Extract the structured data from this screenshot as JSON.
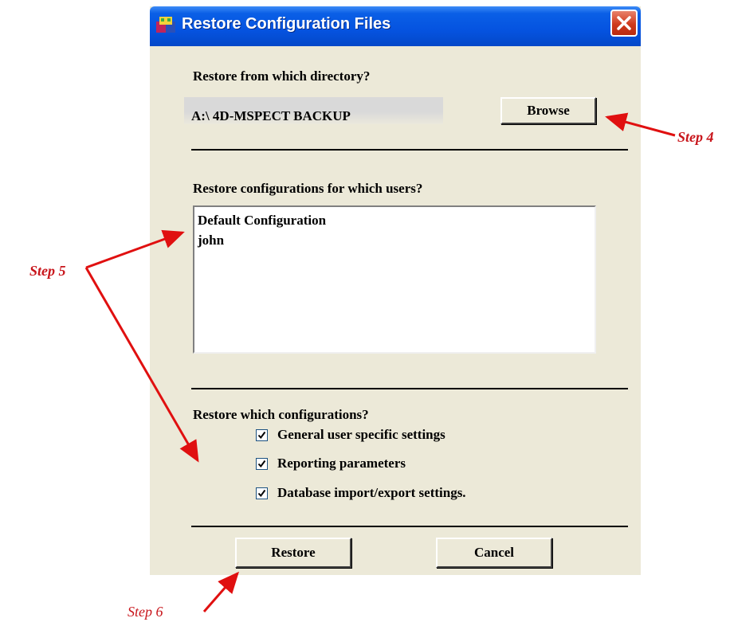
{
  "window": {
    "title": "Restore Configuration Files"
  },
  "directory": {
    "prompt": "Restore from which directory?",
    "value": "A:\\ 4D-MSPECT BACKUP",
    "browse_label": "Browse"
  },
  "users": {
    "prompt": "Restore configurations for which users?",
    "items": [
      "Default Configuration",
      "john"
    ]
  },
  "configs": {
    "prompt": "Restore which configurations?",
    "options": [
      {
        "label": "General user specific settings",
        "checked": true
      },
      {
        "label": "Reporting parameters",
        "checked": true
      },
      {
        "label": "Database import/export settings.",
        "checked": true
      }
    ]
  },
  "actions": {
    "restore_label": "Restore",
    "cancel_label": "Cancel"
  },
  "annotations": {
    "step4": "Step 4",
    "step5": "Step 5",
    "step6": "Step 6",
    "arrow_color": "#e01010"
  }
}
